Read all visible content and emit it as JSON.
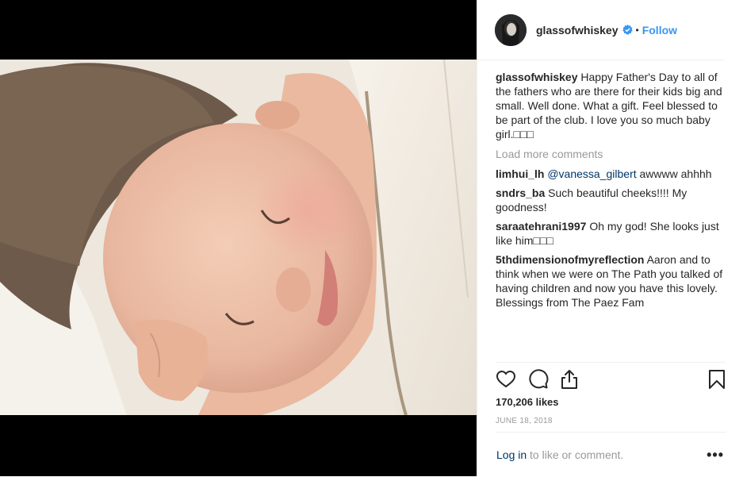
{
  "post": {
    "image_alt": "Sleeping baby on a white pillow"
  },
  "header": {
    "username": "glassofwhiskey",
    "separator": "•",
    "follow_label": "Follow"
  },
  "caption": {
    "username": "glassofwhiskey",
    "text": "Happy Father's Day to all of the fathers who are there for their kids big and small. Well done. What a gift. Feel blessed to be part of the club. I love you so much baby girl.□□□"
  },
  "load_more_label": "Load more comments",
  "comments": [
    {
      "username": "limhui_lh",
      "mention": "@vanessa_gilbert",
      "text": " awwww ahhhh"
    },
    {
      "username": "sndrs_ba",
      "text": "Such beautiful cheeks!!!! My goodness!"
    },
    {
      "username": "saraatehrani1997",
      "text": "Oh my god! She looks just like him□□□"
    },
    {
      "username": "5thdimensionofmyreflection",
      "text": "Aaron and to think when we were on The Path you talked of having children and now you have this lovely. Blessings from The Paez Fam"
    }
  ],
  "likes": "170,206 likes",
  "date": "JUNE 18, 2018",
  "footer": {
    "login_link": "Log in",
    "login_rest": " to like or comment.",
    "more_label": "•••"
  },
  "icons": {
    "like": "heart-icon",
    "comment": "comment-icon",
    "share": "share-icon",
    "save": "bookmark-icon",
    "verified": "verified-badge-icon"
  },
  "colors": {
    "link_blue": "#3897f0",
    "dark_link": "#003569",
    "muted": "#999999"
  }
}
